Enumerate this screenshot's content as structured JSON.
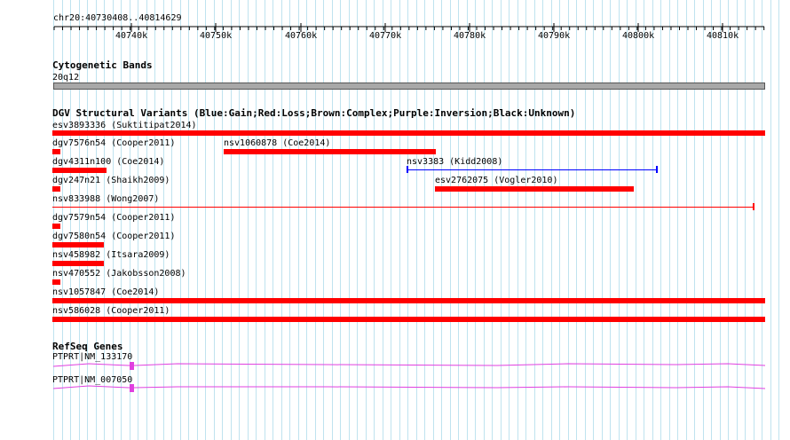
{
  "coord_label": "chr20:40730408..40814629",
  "ruler": {
    "ticks": [
      "40740k",
      "40750k",
      "40760k",
      "40770k",
      "40780k",
      "40790k",
      "40800k",
      "40810k"
    ]
  },
  "cytobands": {
    "title": "Cytogenetic Bands",
    "band": "20q12"
  },
  "dgv": {
    "title": "DGV Structural Variants (Blue:Gain;Red:Loss;Brown:Complex;Purple:Inversion;Black:Unknown)",
    "variants": [
      {
        "label": "esv3893336 (Suktitipat2014)"
      },
      {
        "label": "dgv7576n54 (Cooper2011)"
      },
      {
        "label": "nsv1060878 (Coe2014)"
      },
      {
        "label": "dgv4311n100 (Coe2014)"
      },
      {
        "label": "nsv3383 (Kidd2008)"
      },
      {
        "label": "dgv247n21 (Shaikh2009)"
      },
      {
        "label": "esv2762075 (Vogler2010)"
      },
      {
        "label": "nsv833988 (Wong2007)"
      },
      {
        "label": "dgv7579n54 (Cooper2011)"
      },
      {
        "label": "dgv7580n54 (Cooper2011)"
      },
      {
        "label": "nsv458982 (Itsara2009)"
      },
      {
        "label": "nsv470552 (Jakobsson2008)"
      },
      {
        "label": "nsv1057847 (Coe2014)"
      },
      {
        "label": "nsv586028 (Cooper2011)"
      }
    ]
  },
  "refseq": {
    "title": "RefSeq Genes",
    "genes": [
      {
        "label": "PTPRT|NM_133170"
      },
      {
        "label": "PTPRT|NM_007050"
      }
    ]
  },
  "colors": {
    "loss": "#ff0000",
    "gain": "#0000ff",
    "gene": "#e040e0",
    "grid": "#bfe3ef"
  }
}
